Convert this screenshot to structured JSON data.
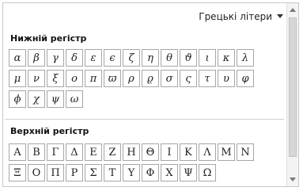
{
  "header": {
    "dropdown_label": "Грецькі літери"
  },
  "lower": {
    "title": "Нижній регістр",
    "symbols": [
      "α",
      "β",
      "γ",
      "δ",
      "ε",
      "ϵ",
      "ζ",
      "η",
      "θ",
      "ϑ",
      "ι",
      "κ",
      "λ",
      "μ",
      "ν",
      "ξ",
      "ο",
      "π",
      "ϖ",
      "ρ",
      "ϱ",
      "σ",
      "ς",
      "τ",
      "υ",
      "φ",
      "ϕ",
      "χ",
      "ψ",
      "ω"
    ]
  },
  "upper": {
    "title": "Верхній регістр",
    "symbols": [
      "Α",
      "Β",
      "Γ",
      "Δ",
      "Ε",
      "Ζ",
      "Η",
      "Θ",
      "Ι",
      "Κ",
      "Λ",
      "Μ",
      "Ν",
      "Ξ",
      "Ο",
      "Π",
      "Ρ",
      "Σ",
      "Τ",
      "Υ",
      "Φ",
      "Χ",
      "Ψ",
      "Ω"
    ]
  }
}
